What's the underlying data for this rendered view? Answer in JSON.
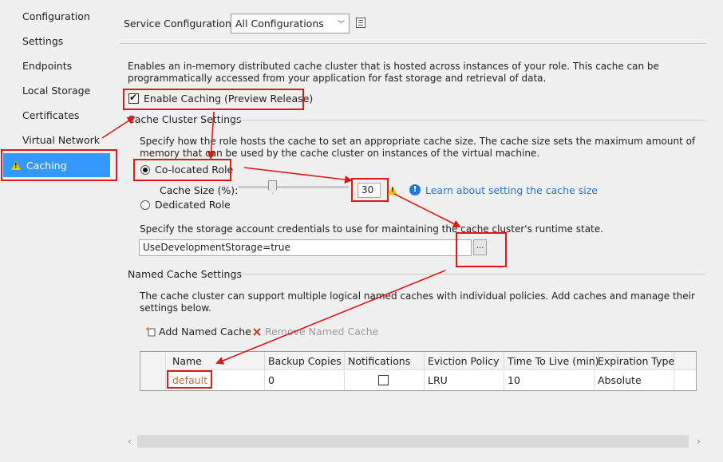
{
  "sidebar": {
    "items": [
      {
        "label": "Configuration"
      },
      {
        "label": "Settings"
      },
      {
        "label": "Endpoints"
      },
      {
        "label": "Local Storage"
      },
      {
        "label": "Certificates"
      },
      {
        "label": "Virtual Network"
      },
      {
        "label": "Caching",
        "icon": "warning-icon",
        "selected": true
      }
    ],
    "selected_color": "#3399ff"
  },
  "header": {
    "service_config_label": "Service Configuration:",
    "service_config_value": "All Configurations"
  },
  "caching": {
    "description": "Enables an in-memory distributed cache cluster that is hosted across instances of your role. This cache can be programmatically accessed from your application for fast storage and retrieval of data.",
    "enable_label": "Enable Caching (Preview Release)",
    "enable_checked": true
  },
  "cluster": {
    "section_title": "Cache Cluster Settings",
    "description": "Specify how the role hosts the cache to set an appropriate cache size. The cache size sets the maximum amount of memory that can be used by the cache cluster on instances of the virtual machine.",
    "colocated_label": "Co-located Role",
    "colocated_selected": true,
    "cache_size_label": "Cache Size (%):",
    "cache_size_value": "30",
    "cache_size_percent": 30,
    "learn_link": "Learn about setting the cache size",
    "dedicated_label": "Dedicated Role",
    "storage_description": "Specify the storage account credentials to use for maintaining the cache cluster's runtime state.",
    "storage_value": "UseDevelopmentStorage=true",
    "browse_label": "..."
  },
  "named": {
    "section_title": "Named Cache Settings",
    "description": "The cache cluster can support multiple logical named caches with individual policies. Add caches and manage their settings below.",
    "add_label": "Add Named Cache",
    "remove_label": "Remove Named Cache",
    "columns": [
      "Name",
      "Backup Copies",
      "Notifications",
      "Eviction Policy",
      "Time To Live (min)",
      "Expiration Type"
    ],
    "rows": [
      {
        "name": "default",
        "backup": "0",
        "notifications": false,
        "eviction": "LRU",
        "ttl": "10",
        "expiration": "Absolute"
      }
    ]
  },
  "colors": {
    "annotation_red": "#e01818",
    "link_blue": "#1e78d6",
    "warning_yellow": "#f5c400"
  }
}
